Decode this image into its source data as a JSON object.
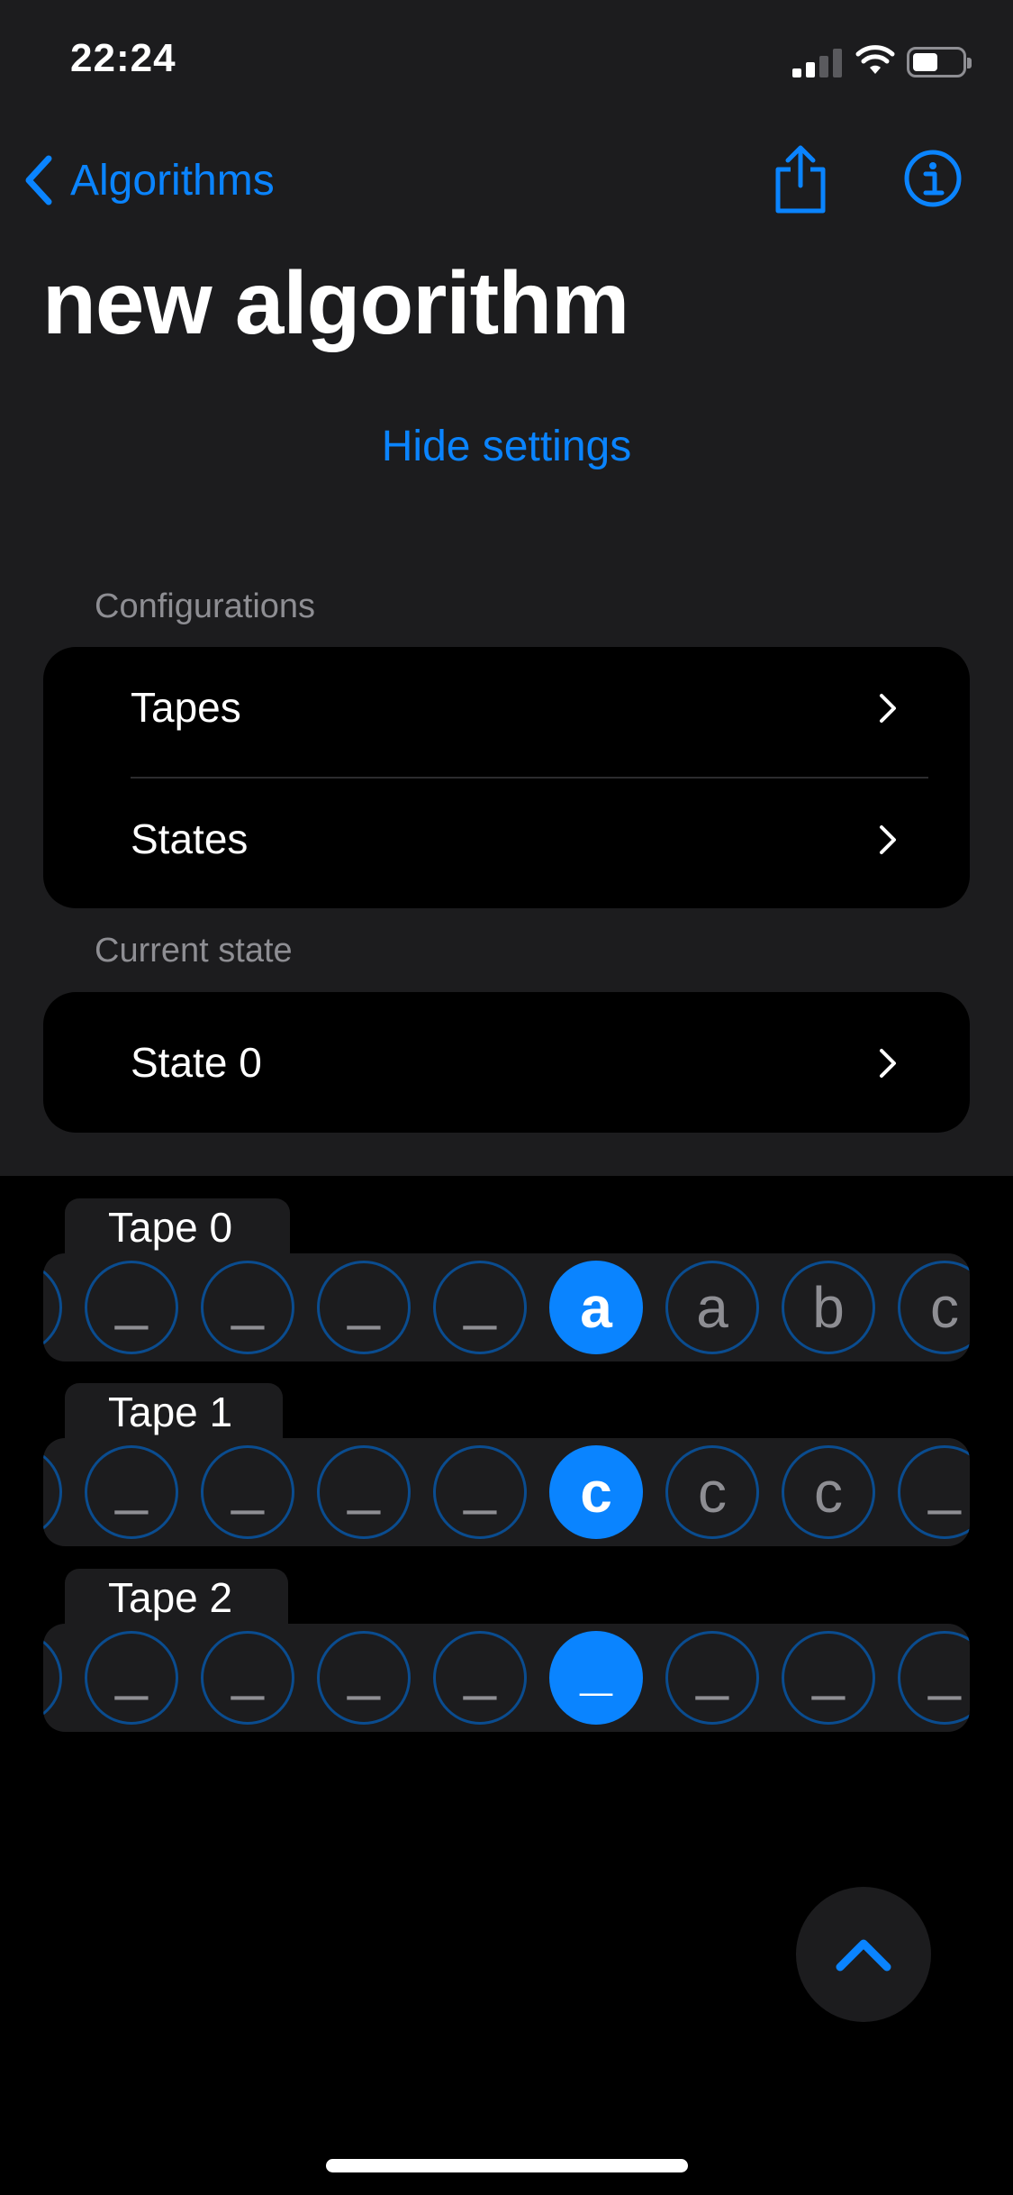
{
  "status_bar": {
    "time": "22:24"
  },
  "nav": {
    "back_label": "Algorithms"
  },
  "title": "new algorithm",
  "hide_settings_label": "Hide settings",
  "configurations": {
    "header": "Configurations",
    "items": [
      {
        "label": "Tapes"
      },
      {
        "label": "States"
      }
    ]
  },
  "current_state": {
    "header": "Current state",
    "value": "State 0"
  },
  "tapes": [
    {
      "label": "Tape 0",
      "head_index": 5,
      "cells": [
        "_",
        "_",
        "_",
        "_",
        "a",
        "a",
        "b",
        "c",
        "_"
      ]
    },
    {
      "label": "Tape 1",
      "head_index": 5,
      "cells": [
        "_",
        "_",
        "_",
        "_",
        "c",
        "c",
        "c",
        "_",
        "_"
      ]
    },
    {
      "label": "Tape 2",
      "head_index": 5,
      "cells": [
        "_",
        "_",
        "_",
        "_",
        "_",
        "_",
        "_",
        "_",
        "_"
      ]
    }
  ],
  "colors": {
    "accent": "#0a84ff",
    "background": "#000000",
    "surface": "#1c1c1e",
    "secondary_text": "#8e8e93"
  },
  "icons": [
    "chevron-left-icon",
    "share-icon",
    "info-icon",
    "chevron-right-icon",
    "chevron-up-icon"
  ]
}
